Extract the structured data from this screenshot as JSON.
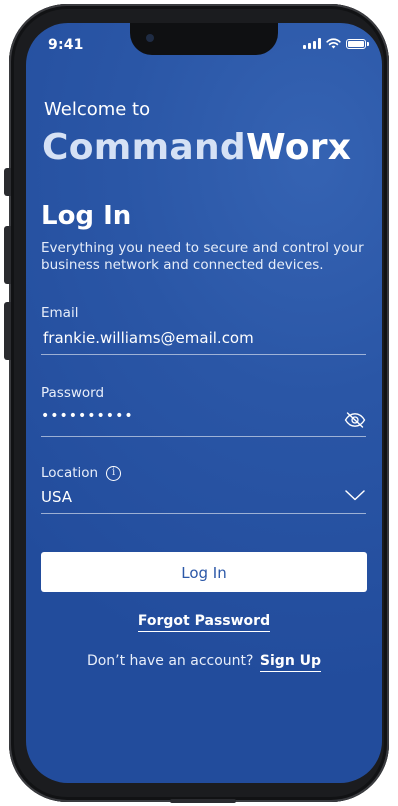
{
  "status_bar": {
    "time": "9:41",
    "icons": [
      "signal-icon",
      "wifi-icon",
      "battery-icon"
    ]
  },
  "header": {
    "welcome": "Welcome to",
    "brand_part1": "Command",
    "brand_part2": "Worx"
  },
  "login": {
    "title": "Log In",
    "subtitle": "Everything you need to secure and control your business network and connected devices."
  },
  "form": {
    "email": {
      "label": "Email",
      "value": "frankie.williams@email.com"
    },
    "password": {
      "label": "Password",
      "value": "••••••••••",
      "toggle_icon": "eye-slash-icon"
    },
    "location": {
      "label": "Location",
      "info_icon": "info-icon",
      "value": "USA",
      "dropdown_icon": "chevron-down-icon"
    }
  },
  "actions": {
    "login_label": "Log In",
    "forgot_label": "Forgot Password",
    "signup_prompt": "Don’t have an account?",
    "signup_label": "Sign Up"
  },
  "colors": {
    "background": "#2a56a6",
    "button_bg": "#ffffff",
    "button_text": "#2c58a8",
    "brand_light": "#d5e1f5"
  }
}
